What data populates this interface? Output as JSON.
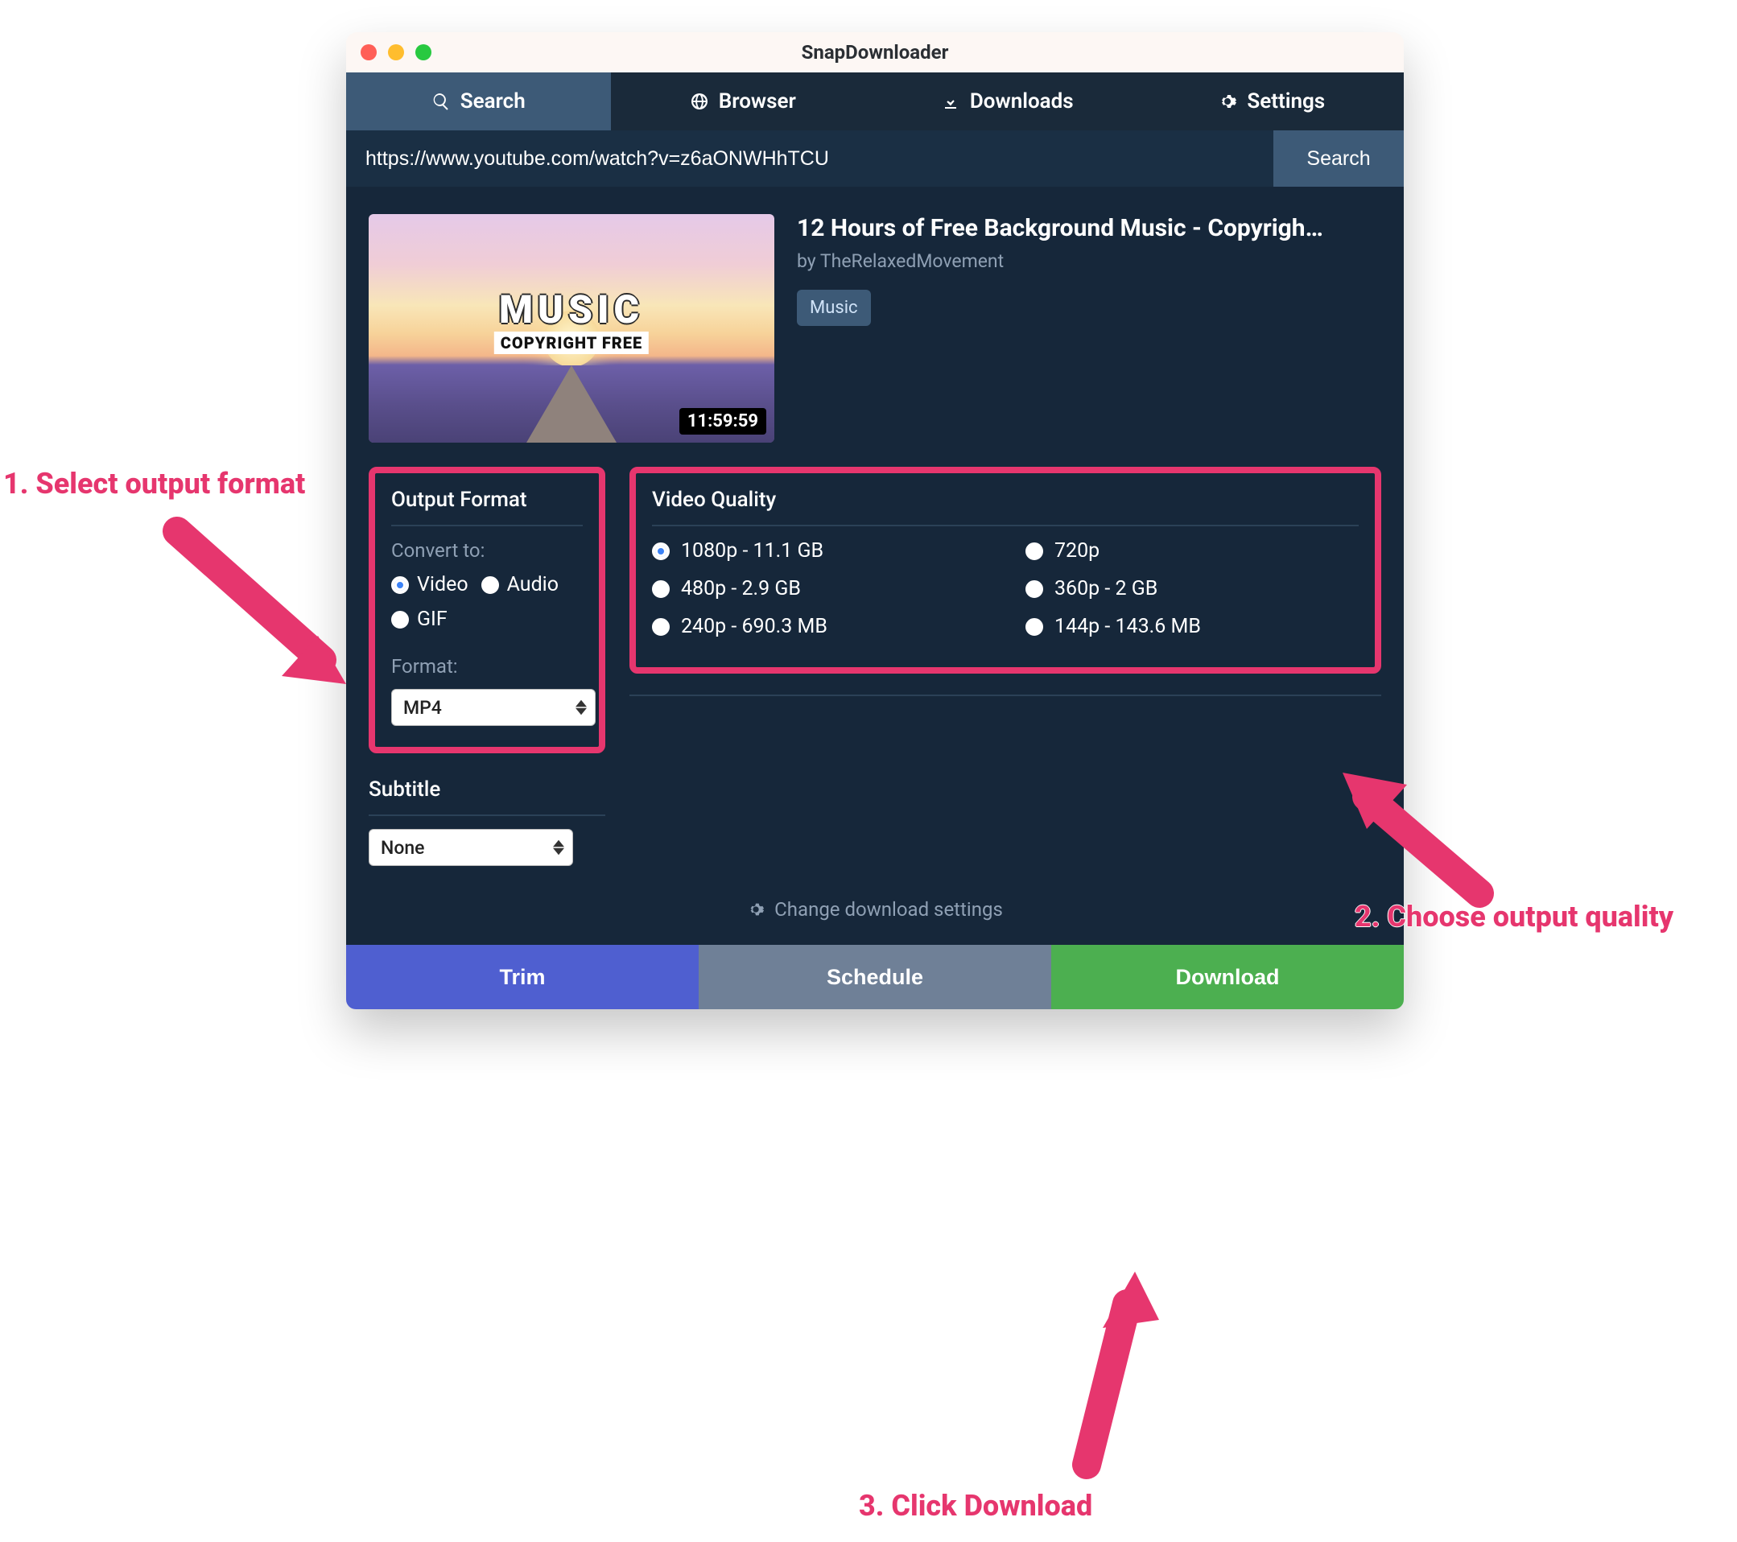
{
  "app": {
    "title": "SnapDownloader"
  },
  "tabs": {
    "search": "Search",
    "browser": "Browser",
    "downloads": "Downloads",
    "settings": "Settings",
    "active": "search"
  },
  "searchbar": {
    "value": "https://www.youtube.com/watch?v=z6aONWHhTCU",
    "button": "Search"
  },
  "video": {
    "title": "12 Hours of Free Background Music - Copyrigh…",
    "by": "by TheRelaxedMovement",
    "badge": "Music",
    "duration": "11:59:59",
    "thumb_text1": "MUSIC",
    "thumb_text2": "COPYRIGHT FREE"
  },
  "output_format": {
    "title": "Output Format",
    "convert_to_label": "Convert to:",
    "options": {
      "video": "Video",
      "audio": "Audio",
      "gif": "GIF"
    },
    "selected": "video",
    "format_label": "Format:",
    "format_value": "MP4"
  },
  "video_quality": {
    "title": "Video Quality",
    "items": [
      {
        "label": "1080p - 11.1 GB",
        "selected": true
      },
      {
        "label": "720p",
        "selected": false
      },
      {
        "label": "480p - 2.9 GB",
        "selected": false
      },
      {
        "label": "360p - 2 GB",
        "selected": false
      },
      {
        "label": "240p - 690.3 MB",
        "selected": false
      },
      {
        "label": "144p - 143.6 MB",
        "selected": false
      }
    ]
  },
  "subtitle": {
    "title": "Subtitle",
    "value": "None"
  },
  "settings_link": "Change download settings",
  "actions": {
    "trim": "Trim",
    "schedule": "Schedule",
    "download": "Download"
  },
  "annotations": {
    "a1": "1. Select output format",
    "a2": "2. Choose output quality",
    "a3": "3. Click Download"
  }
}
